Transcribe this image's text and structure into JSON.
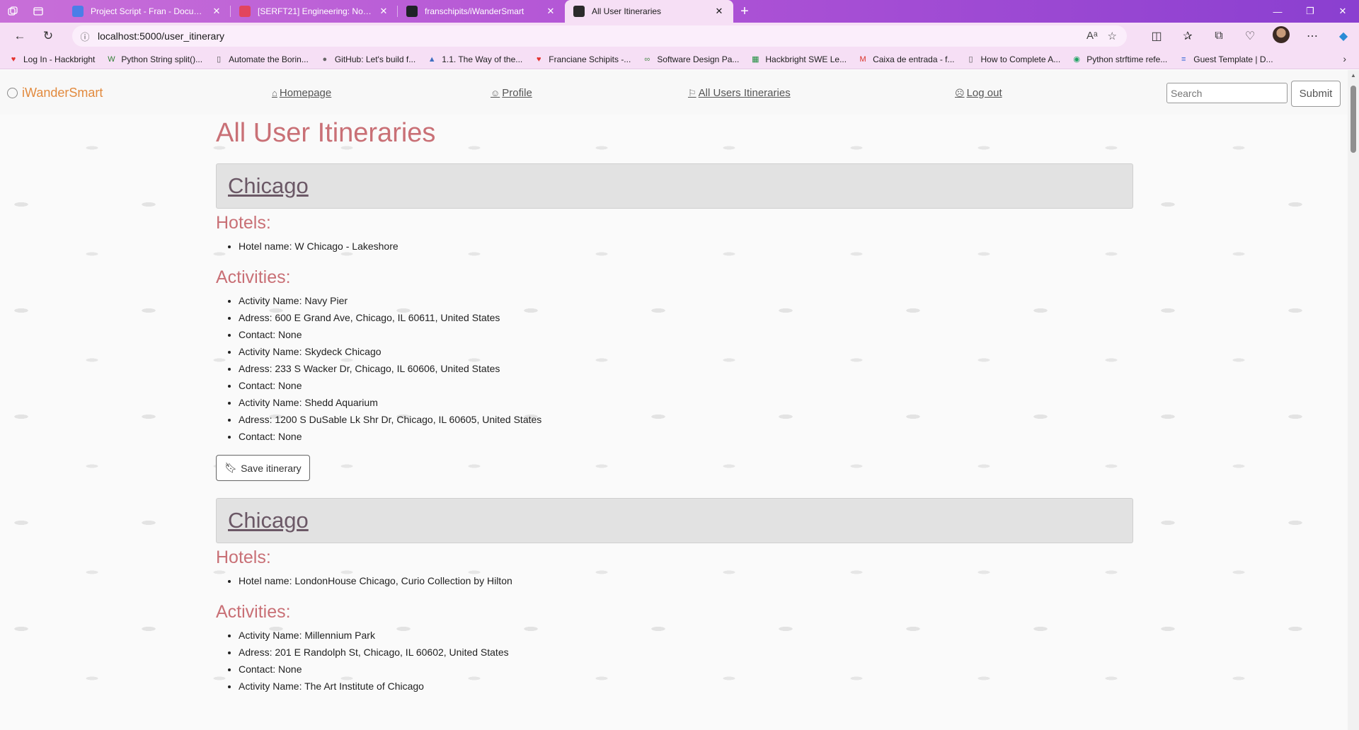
{
  "browser": {
    "tabs": [
      {
        "title": "Project Script - Fran - Documents",
        "favicon_color": "#4a7ee8"
      },
      {
        "title": "[SERFT21] Engineering: Nov '23 / ...",
        "favicon_color": "#e2455e"
      },
      {
        "title": "franschipits/iWanderSmart",
        "favicon_color": "#1f2328"
      },
      {
        "title": "All User Itineraries",
        "favicon_color": "#2b2b2b"
      }
    ],
    "active_tab_index": 3,
    "url": "localhost:5000/user_itinerary",
    "bookmarks": [
      {
        "label": "Log In - Hackbright",
        "icon": "heart-icon",
        "color": "#e4322f"
      },
      {
        "label": "Python String split()...",
        "icon": "w-logo-icon",
        "color": "#2e7d32"
      },
      {
        "label": "Automate the Borin...",
        "icon": "page-icon",
        "color": "#555555"
      },
      {
        "label": "GitHub: Let's build f...",
        "icon": "github-icon",
        "color": "#666666"
      },
      {
        "label": "1.1. The Way of the...",
        "icon": "triangle-icon",
        "color": "#3f6fc1"
      },
      {
        "label": "Franciane Schipits -...",
        "icon": "heart-icon",
        "color": "#e4322f"
      },
      {
        "label": "Software Design Pa...",
        "icon": "pattern-icon",
        "color": "#4a8a4a"
      },
      {
        "label": "Hackbright SWE Le...",
        "icon": "sheet-icon",
        "color": "#1e8e3e"
      },
      {
        "label": "Caixa de entrada - f...",
        "icon": "gmail-icon",
        "color": "#d93025"
      },
      {
        "label": "How to Complete A...",
        "icon": "page-icon",
        "color": "#555555"
      },
      {
        "label": "Python strftime refe...",
        "icon": "circle-arrow-icon",
        "color": "#1ea362"
      },
      {
        "label": "Guest Template | D...",
        "icon": "database-icon",
        "color": "#3b6bd6"
      }
    ]
  },
  "site": {
    "brand": "iWanderSmart",
    "nav": [
      {
        "label": "Homepage",
        "icon": "home-icon"
      },
      {
        "label": "Profile",
        "icon": "smile-icon"
      },
      {
        "label": "All Users Itineraries",
        "icon": "signpost-icon"
      },
      {
        "label": "Log out",
        "icon": "frown-icon"
      }
    ],
    "search_placeholder": "Search",
    "submit_label": "Submit"
  },
  "page": {
    "title": "All User Itineraries",
    "hotels_heading": "Hotels:",
    "activities_heading": "Activities:",
    "save_label": "Save itinerary",
    "itineraries": [
      {
        "city": "Chicago",
        "hotels": [
          "Hotel name: W Chicago - Lakeshore"
        ],
        "activities": [
          "Activity Name: Navy Pier",
          "Adress: 600 E Grand Ave, Chicago, IL 60611, United States",
          "Contact: None",
          "Activity Name: Skydeck Chicago",
          "Adress: 233 S Wacker Dr, Chicago, IL 60606, United States",
          "Contact: None",
          "Activity Name: Shedd Aquarium",
          "Adress: 1200 S DuSable Lk Shr Dr, Chicago, IL 60605, United States",
          "Contact: None"
        ]
      },
      {
        "city": "Chicago",
        "hotels": [
          "Hotel name: LondonHouse Chicago, Curio Collection by Hilton"
        ],
        "activities": [
          "Activity Name: Millennium Park",
          "Adress: 201 E Randolph St, Chicago, IL 60602, United States",
          "Contact: None",
          "Activity Name: The Art Institute of Chicago"
        ]
      }
    ]
  }
}
